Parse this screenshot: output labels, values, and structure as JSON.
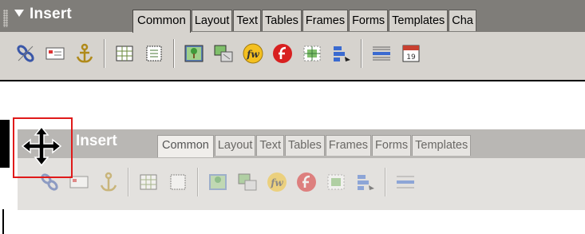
{
  "panel": {
    "title": "Insert",
    "tabs": [
      "Common",
      "Layout",
      "Text",
      "Tables",
      "Frames",
      "Forms",
      "Templates",
      "Cha"
    ]
  },
  "ghost_panel": {
    "title": "Insert",
    "tabs": [
      "Common",
      "Layout",
      "Text",
      "Tables",
      "Frames",
      "Forms",
      "Templates"
    ]
  },
  "toolbar_icons": [
    "hyperlink-icon",
    "email-link-icon",
    "named-anchor-icon",
    "table-icon",
    "layer-icon",
    "image-icon",
    "image-placeholder-icon",
    "fireworks-html-icon",
    "flash-icon",
    "rollover-image-icon",
    "navigation-bar-icon",
    "horizontal-rule-icon",
    "date-icon"
  ],
  "colors": {
    "panel_header": "#7f7d79",
    "panel_body": "#d6d3ce",
    "highlight": "#e01a1a"
  },
  "cursor": "move-cursor-icon"
}
